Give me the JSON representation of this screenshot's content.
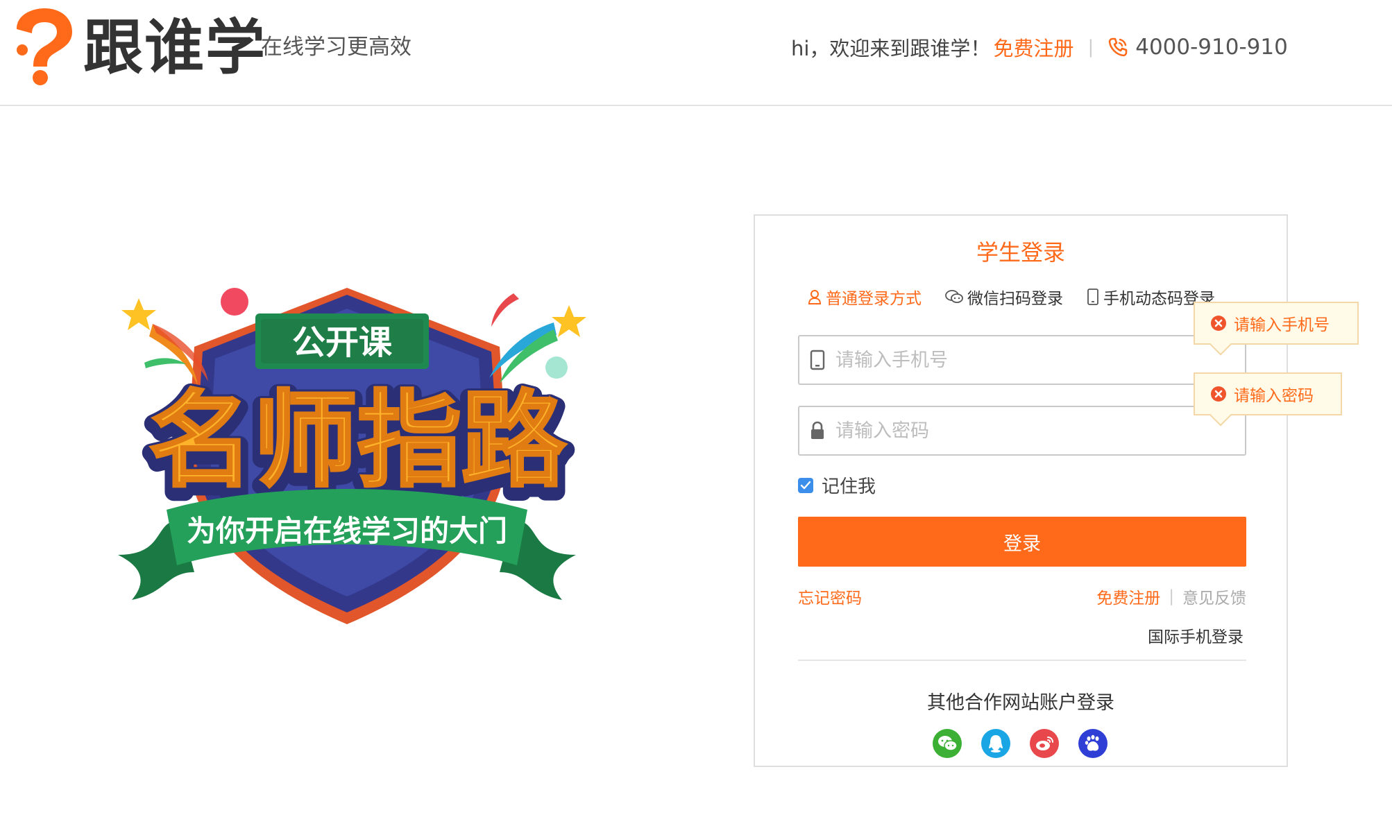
{
  "header": {
    "brand": "跟谁学",
    "slogan": "在线学习更高效",
    "welcome": "hi，欢迎来到跟谁学！",
    "register_label": "免费注册",
    "separator": "|",
    "phone": "4000-910-910"
  },
  "banner": {
    "badge_text": "公开课",
    "headline": "名师指路",
    "ribbon_text": "为你开启在线学习的大门"
  },
  "login": {
    "title": "学生登录",
    "tabs": [
      {
        "label": "普通登录方式",
        "active": true,
        "icon": "user-icon"
      },
      {
        "label": "微信扫码登录",
        "active": false,
        "icon": "wechat-icon"
      },
      {
        "label": "手机动态码登录",
        "active": false,
        "icon": "mobile-icon"
      }
    ],
    "phone_placeholder": "请输入手机号",
    "password_placeholder": "请输入密码",
    "phone_error": "请输入手机号",
    "password_error": "请输入密码",
    "remember_label": "记住我",
    "remember_checked": true,
    "submit_label": "登录",
    "forgot_label": "忘记密码",
    "register_label": "免费注册",
    "separator": "|",
    "feedback_label": "意见反馈",
    "intl_label": "国际手机登录",
    "partner_title": "其他合作网站账户登录",
    "partners": [
      "wechat-icon",
      "qq-icon",
      "weibo-icon",
      "baidu-icon"
    ]
  },
  "colors": {
    "accent": "#ff6a1a",
    "error_bg": "#fffbe8",
    "checkbox": "#3b8eea",
    "wechat": "#3cb034",
    "qq": "#1aa6e4",
    "weibo": "#e8474c",
    "baidu": "#2f3fd6"
  }
}
